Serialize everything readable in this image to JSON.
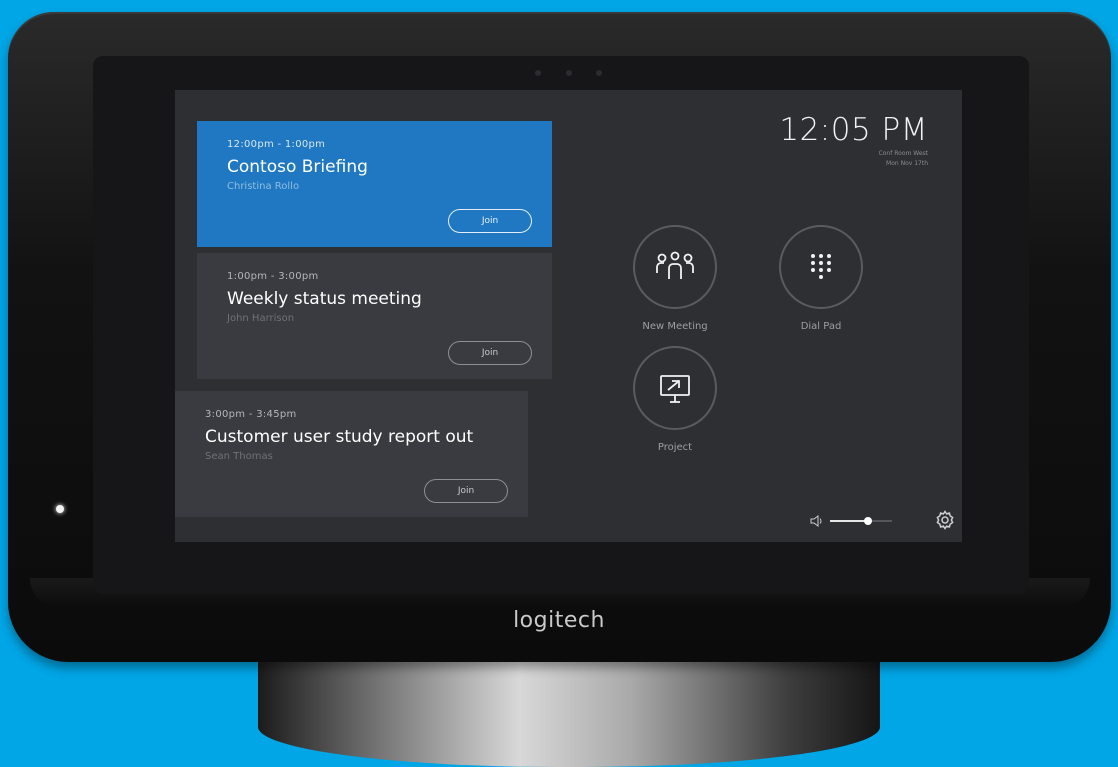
{
  "device": {
    "brand": "logitech"
  },
  "clock": {
    "time": "12:05 PM",
    "location": "Conf Room West",
    "date": "Mon Nov 17th"
  },
  "meetings": [
    {
      "time": "12:00pm - 1:00pm",
      "title": "Contoso Briefing",
      "organizer": "Christina Rollo",
      "join_label": "Join"
    },
    {
      "time": "1:00pm - 3:00pm",
      "title": "Weekly status meeting",
      "organizer": "John Harrison",
      "join_label": "Join"
    },
    {
      "time": "3:00pm - 3:45pm",
      "title": "Customer user study report out",
      "organizer": "Sean Thomas",
      "join_label": "Join"
    }
  ],
  "actions": {
    "new_meeting": "New Meeting",
    "dial_pad": "Dial Pad",
    "project": "Project"
  },
  "volume": {
    "level": 0.62
  },
  "colors": {
    "background": "#00a6e6",
    "accent": "#1f78c1",
    "screen": "#2e2f33"
  },
  "icons": [
    "people-icon",
    "dialpad-icon",
    "project-icon",
    "volume-icon",
    "gear-icon"
  ]
}
